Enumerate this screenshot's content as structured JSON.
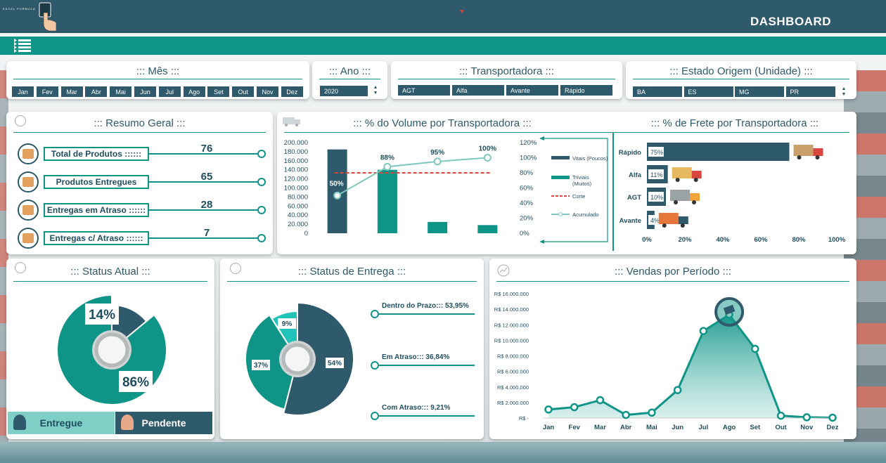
{
  "header": {
    "title": "DASHBOARD",
    "logo_text": "EXCEL FORMULA"
  },
  "filters": {
    "mes": {
      "title": "::: Mês :::",
      "months": [
        "Jan",
        "Fev",
        "Mar",
        "Abr",
        "Mai",
        "Jun",
        "Jul",
        "Ago",
        "Set",
        "Out",
        "Nov",
        "Dez"
      ]
    },
    "ano": {
      "title": "::: Ano :::",
      "value": "2020"
    },
    "transportadora": {
      "title": "::: Transportadora :::",
      "items": [
        "AGT",
        "Alfa",
        "Avante",
        "Rápido"
      ]
    },
    "estado": {
      "title": "::: Estado Origem (Unidade) :::",
      "items": [
        "BA",
        "ES",
        "MG",
        "PR"
      ]
    }
  },
  "resumo": {
    "title": "::: Resumo Geral :::",
    "items": [
      {
        "label": "Total de Produtos ::::::",
        "value": "76"
      },
      {
        "label": "Produtos Entregues",
        "value": "65"
      },
      {
        "label": "Entregas em Atraso ::::::",
        "value": "28"
      },
      {
        "label": "Entregas c/ Atraso ::::::",
        "value": "7"
      }
    ]
  },
  "status_atual": {
    "title": "::: Status Atual :::",
    "entregue_label": "Entregue",
    "pendente_label": "Pendente"
  },
  "status_entrega": {
    "title": "::: Status de Entrega :::",
    "legend": [
      "Dentro do Prazo::: 53,95%",
      "Em Atraso::: 36,84%",
      "Com Atraso::: 9,21%"
    ]
  },
  "colors": {
    "navy": "#2f5a6b",
    "teal": "#0f9488",
    "light_teal": "#22c3b8",
    "corte": "#d9463e",
    "acumulado": "#7fc8bf"
  },
  "chart_data": [
    {
      "type": "bar",
      "title": "::: % do Volume por Transportadora :::",
      "categories": [
        "",
        "",
        "",
        ""
      ],
      "series": [
        {
          "name": "Vitais (Poucos)",
          "values": [
            185000,
            0,
            0,
            0
          ]
        },
        {
          "name": "Triviais (Muitos)",
          "values": [
            0,
            140000,
            25000,
            18000
          ]
        },
        {
          "name": "Corte",
          "values": [
            80,
            80,
            80,
            80
          ]
        },
        {
          "name": "Acumulado",
          "values": [
            50,
            88,
            95,
            100
          ]
        }
      ],
      "data_labels": [
        "50%",
        "88%",
        "95%",
        "100%"
      ],
      "y_ticks": [
        "200.000",
        "180.000",
        "160.000",
        "140.000",
        "120.000",
        "100.000",
        "80.000",
        "60.000",
        "40.000",
        "20.000",
        "0"
      ],
      "y2_ticks": [
        "120%",
        "100%",
        "80%",
        "60%",
        "40%",
        "20%",
        "0%"
      ],
      "ylim": [
        0,
        200000
      ],
      "y2lim": [
        0,
        120
      ]
    },
    {
      "type": "bar",
      "title": "::: % de Frete por Transportadora :::",
      "orientation": "horizontal",
      "categories": [
        "Rápido",
        "Alfa",
        "AGT",
        "Avante"
      ],
      "values": [
        75,
        11,
        10,
        4
      ],
      "data_labels": [
        "75%",
        "11%",
        "10%",
        "4%"
      ],
      "x_ticks": [
        "0%",
        "20%",
        "40%",
        "60%",
        "80%",
        "100%"
      ],
      "xlim": [
        0,
        100
      ]
    },
    {
      "type": "pie",
      "title": "::: Status Atual :::",
      "labels": [
        "Entregue",
        "Pendente"
      ],
      "values": [
        86,
        14
      ],
      "data_labels": [
        "86%",
        "14%"
      ]
    },
    {
      "type": "pie",
      "title": "::: Status de Entrega :::",
      "labels": [
        "Dentro do Prazo",
        "Em Atraso",
        "Com Atraso"
      ],
      "values": [
        54,
        37,
        9
      ],
      "data_labels": [
        "54%",
        "37%",
        "9%"
      ]
    },
    {
      "type": "area",
      "title": "::: Vendas por Período :::",
      "categories": [
        "Jan",
        "Fev",
        "Mar",
        "Abr",
        "Mai",
        "Jun",
        "Jul",
        "Ago",
        "Set",
        "Out",
        "Nov",
        "Dez"
      ],
      "values": [
        1100000,
        1400000,
        2300000,
        400000,
        700000,
        3600000,
        11200000,
        13300000,
        8900000,
        300000,
        100000,
        50000
      ],
      "y_ticks": [
        "R$ 16.000.000",
        "R$ 14.000.000",
        "R$ 12.000.000",
        "R$ 10.000.000",
        "R$ 8.000.000",
        "R$ 6.000.000",
        "R$ 4.000.000",
        "R$ 2.000.000",
        "R$ -"
      ],
      "ylim": [
        0,
        16000000
      ]
    }
  ]
}
